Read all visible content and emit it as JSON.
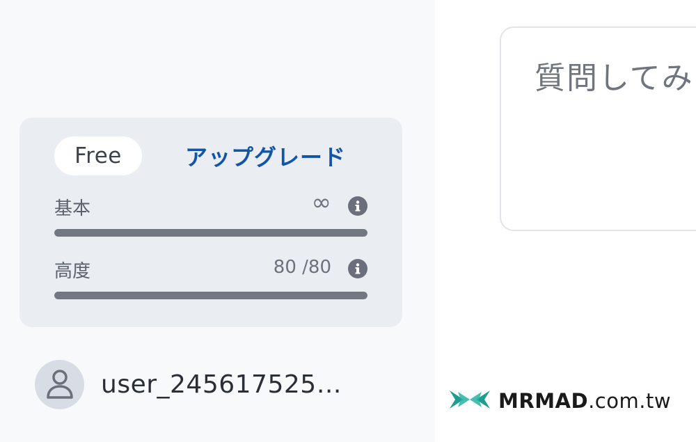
{
  "plan_card": {
    "plan_name": "Free",
    "upgrade_label": "アップグレード",
    "quotas": [
      {
        "label": "基本",
        "value": "∞",
        "fill_fraction": 1.0
      },
      {
        "label": "高度",
        "value": "80 /80",
        "fill_fraction": 1.0
      }
    ]
  },
  "user": {
    "username": "user_245617525…"
  },
  "prompt": {
    "placeholder": "質問してみ"
  },
  "watermark": {
    "brand": "MRMAD",
    "domain": ".com.tw"
  },
  "icons": {
    "info": "info-icon",
    "avatar": "user-icon",
    "brand_logo": "mrmad-logo"
  },
  "colors": {
    "accent": "#1255a8",
    "bar_fill": "#737782",
    "card_bg": "#eaeef3",
    "logo_teal": "#1e9c8f"
  }
}
